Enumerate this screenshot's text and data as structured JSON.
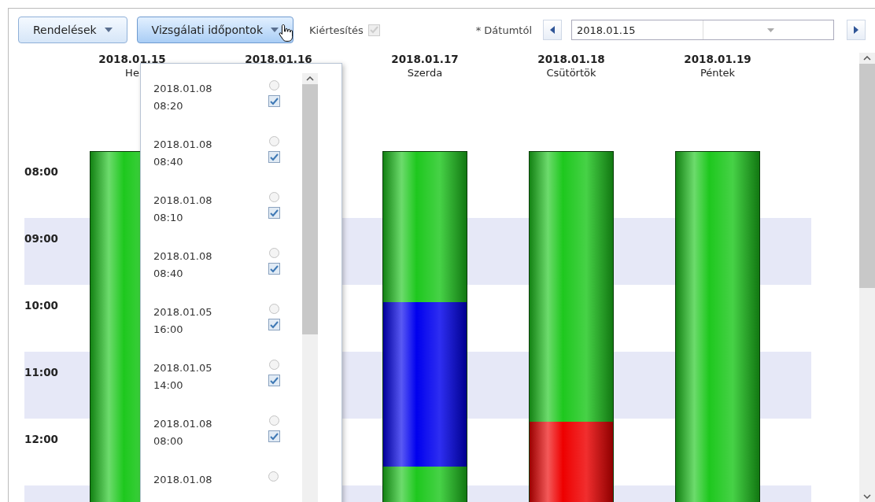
{
  "toolbar": {
    "buttons": [
      {
        "label": "Rendelések",
        "expanded": false
      },
      {
        "label": "Vizsgálati időpontok",
        "expanded": true
      }
    ],
    "notify": {
      "label": "Kiértesítés",
      "checked": true,
      "disabled": true
    },
    "date_from": {
      "label": "* Dátumtól",
      "value": "2018.01.15"
    }
  },
  "days": [
    {
      "date": "2018.01.15",
      "weekday": "He",
      "segments": [
        {
          "color": "#1ec81e",
          "level": 1
        }
      ]
    },
    {
      "date": "2018.01.16"
    },
    {
      "date": "2018.01.17",
      "weekday": "Szerda",
      "segments": [
        {
          "color": "#1ec81e",
          "level": 0.43
        },
        {
          "color": "#0000ee",
          "level": 0.47
        },
        {
          "color": "#1ec81e",
          "level": 0.1
        }
      ]
    },
    {
      "date": "2018.01.18",
      "weekday": "Csütörtök",
      "segments": [
        {
          "color": "#1ec81e",
          "level": 0.77
        },
        {
          "color": "#ee0000",
          "level": 0.23
        }
      ]
    },
    {
      "date": "2018.01.19",
      "weekday": "Péntek",
      "segments": [
        {
          "color": "#1ec81e",
          "level": 1
        }
      ]
    }
  ],
  "hours": [
    "08:00",
    "09:00",
    "10:00",
    "11:00",
    "12:00"
  ],
  "appointments_popup": {
    "items": [
      {
        "date": "2018.01.08",
        "time": "08:20",
        "selected": false,
        "checked": true
      },
      {
        "date": "2018.01.08",
        "time": "08:40",
        "selected": false,
        "checked": true
      },
      {
        "date": "2018.01.08",
        "time": "08:10",
        "selected": false,
        "checked": true
      },
      {
        "date": "2018.01.08",
        "time": "08:40",
        "selected": false,
        "checked": true
      },
      {
        "date": "2018.01.05",
        "time": "16:00",
        "selected": false,
        "checked": true
      },
      {
        "date": "2018.01.05",
        "time": "14:00",
        "selected": false,
        "checked": true
      },
      {
        "date": "2018.01.08",
        "time": "08:00",
        "selected": false,
        "checked": true
      },
      {
        "date": "2018.01.08",
        "selected": false
      }
    ]
  }
}
